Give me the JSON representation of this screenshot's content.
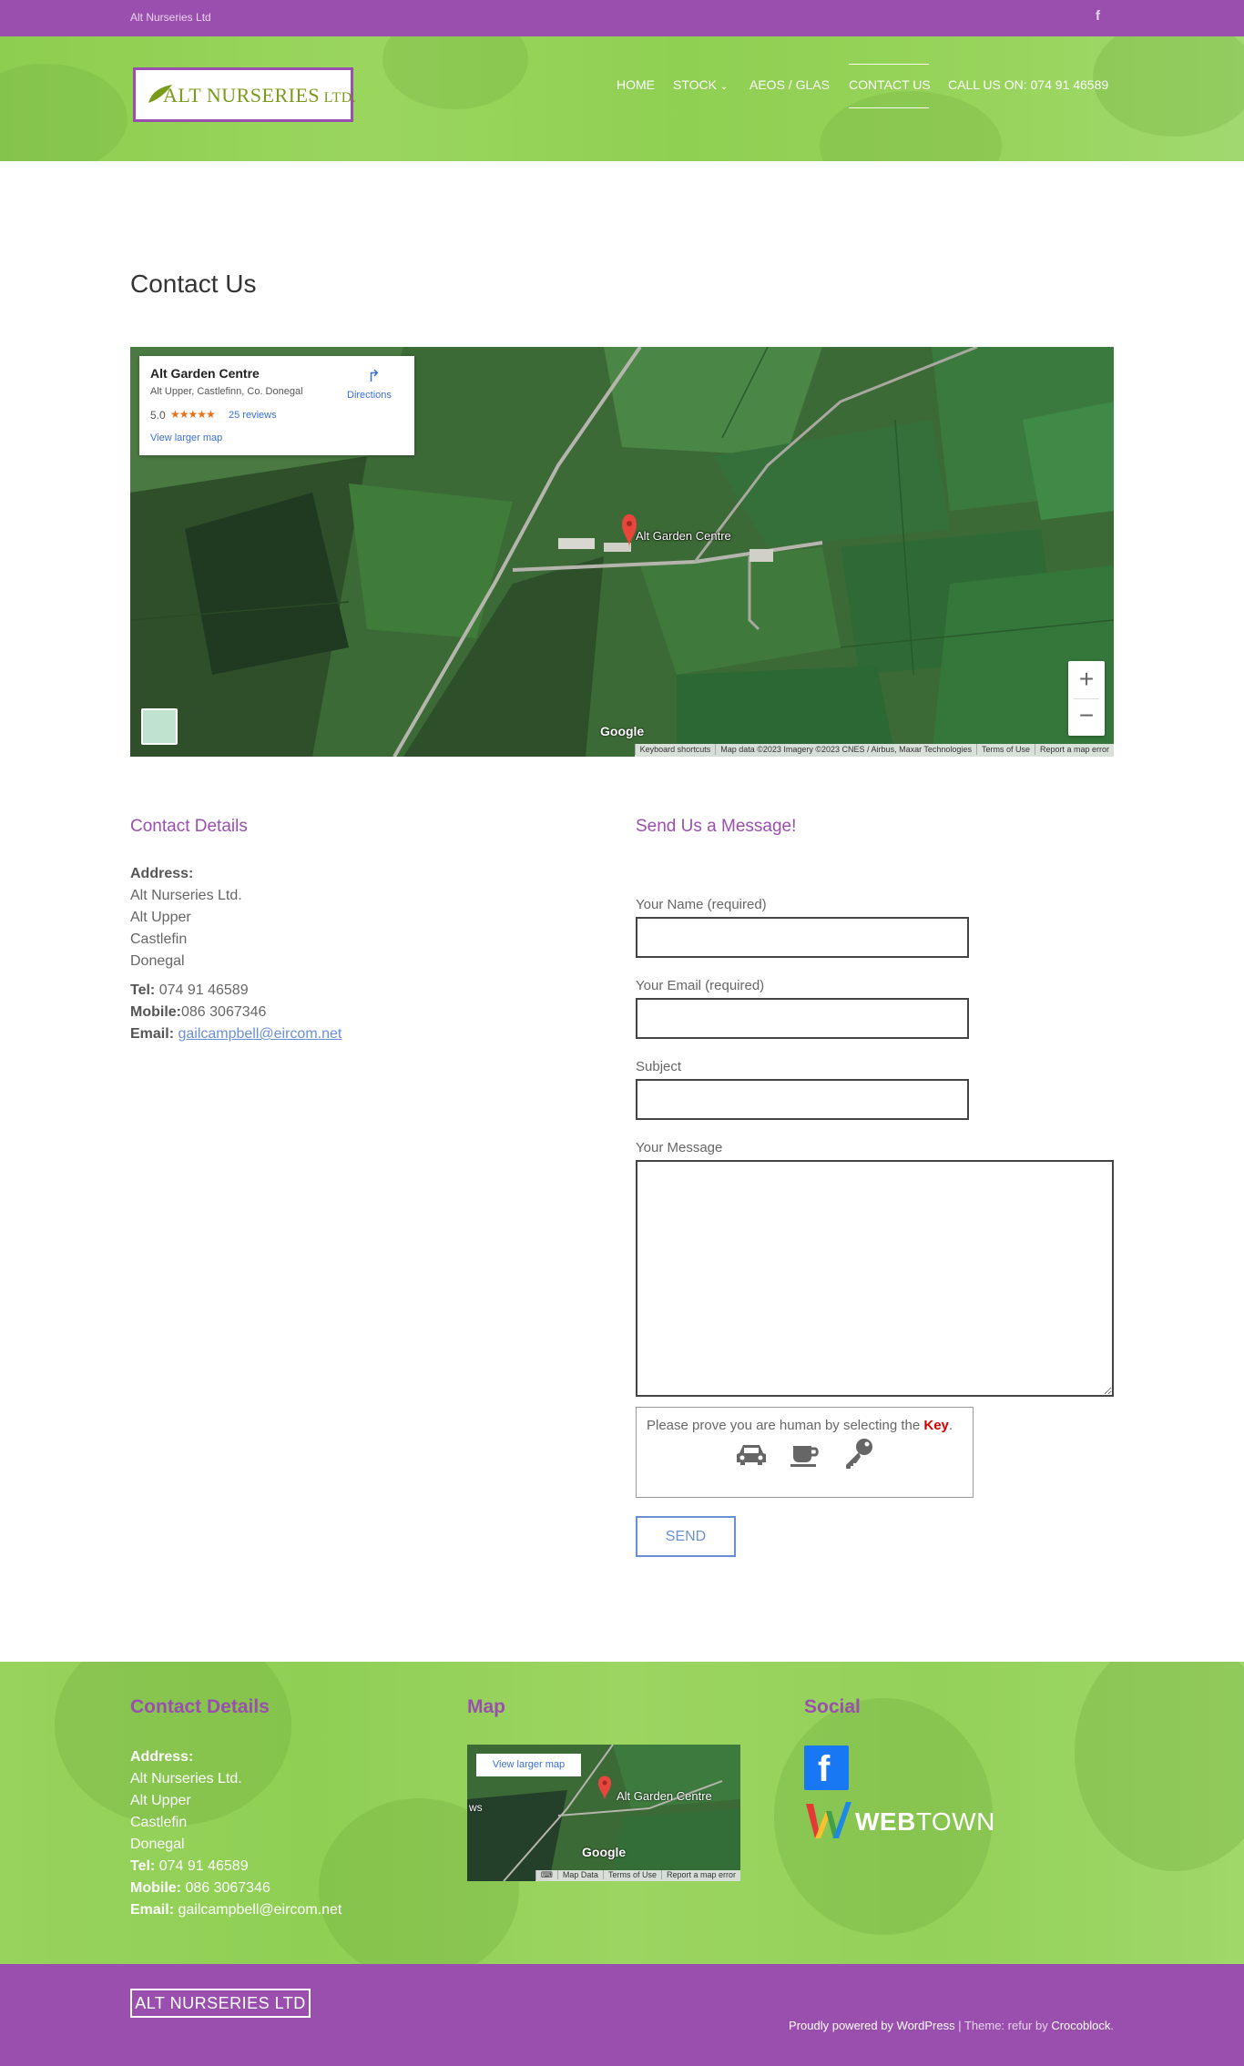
{
  "topbar": {
    "company": "Alt Nurseries Ltd",
    "social_icon": "facebook-icon"
  },
  "header": {
    "logo_text_big": "ALT NURSERIES",
    "logo_text_small": " LTD.",
    "nav": [
      {
        "label": "HOME"
      },
      {
        "label": "STOCK"
      },
      {
        "label": "AEOS / GLAS"
      },
      {
        "label": "CONTACT US"
      },
      {
        "label": "CALL US ON: 074 91 46589"
      }
    ]
  },
  "page": {
    "title": "Contact Us"
  },
  "map": {
    "place_name": "Alt Garden Centre",
    "address": "Alt Upper, Castlefinn, Co. Donegal",
    "rating": "5.0",
    "stars": "★★★★★",
    "reviews": "25 reviews",
    "larger_map": "View larger map",
    "directions": "Directions",
    "pin_label": "Alt Garden Centre",
    "google": "Google",
    "attribution": [
      "Keyboard shortcuts",
      "Map data ©2023 Imagery ©2023 CNES / Airbus, Maxar Technologies",
      "Terms of Use",
      "Report a map error"
    ],
    "zoom_in": "+",
    "zoom_out": "−"
  },
  "contact_details": {
    "heading": "Contact Details",
    "address_label": "Address:",
    "address_lines": [
      "Alt Nurseries Ltd.",
      "Alt Upper",
      "Castlefin",
      "Donegal"
    ],
    "tel_label": "Tel:",
    "tel": " 074 91 46589",
    "mobile_label": "Mobile:",
    "mobile": "086 3067346",
    "email_label": "Email:",
    "email": "gailcampbell@eircom.net"
  },
  "form": {
    "heading": "Send Us a Message!",
    "name_label": "Your Name (required)",
    "email_label": "Your Email (required)",
    "subject_label": "Subject",
    "message_label": "Your Message",
    "captcha_text": "Please prove you are human by selecting the ",
    "captcha_key": "Key",
    "captcha_end": ".",
    "captcha_icons": [
      "car-icon",
      "coffee-cup-icon",
      "key-icon"
    ],
    "send_label": "SEND"
  },
  "footer": {
    "contact_heading": "Contact Details",
    "map_heading": "Map",
    "social_heading": "Social",
    "address_label": "Address:",
    "address_lines": [
      "Alt Nurseries Ltd.",
      "Alt Upper",
      "Castlefin",
      "Donegal"
    ],
    "tel_label": "Tel:",
    "tel": " 074 91 46589",
    "mobile_label": "Mobile:",
    "mobile": " 086 3067346",
    "email_label": "Email:",
    "email": " gailcampbell@eircom.net",
    "map_larger": "View larger map",
    "map_pin_label": "Alt Garden Centre",
    "map_ws": "ws",
    "map_google": "Google",
    "map_attribution": [
      "Map Data",
      "Terms of Use",
      "Report a map error"
    ],
    "webtown_bold": "WEB",
    "webtown_light": "TOWN"
  },
  "bottom": {
    "logo": "ALT NURSERIES LTD",
    "powered": "Proudly powered by WordPress",
    "theme": " | Theme: refur by ",
    "author": "Crocoblock",
    "end": "."
  },
  "colors": {
    "purple": "#9a4fae",
    "green": "#8fcf54",
    "link": "#6b8fd4"
  }
}
